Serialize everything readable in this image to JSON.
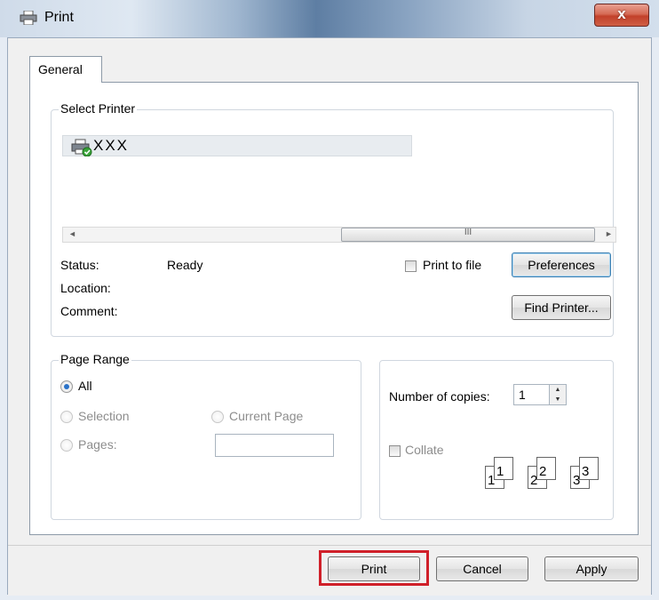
{
  "window": {
    "title": "Print",
    "close_label": "x"
  },
  "tabs": [
    {
      "label": "General"
    }
  ],
  "select_printer": {
    "group_label": "Select Printer",
    "printers": [
      {
        "name": "XXX"
      }
    ],
    "status_label": "Status:",
    "status_value": "Ready",
    "location_label": "Location:",
    "comment_label": "Comment:",
    "print_to_file_label": "Print to file",
    "print_to_file_checked": false,
    "preferences_label": "Preferences",
    "find_printer_label": "Find Printer...",
    "scrollbar_grip": "III"
  },
  "page_range": {
    "group_label": "Page Range",
    "all_label": "All",
    "selection_label": "Selection",
    "current_page_label": "Current Page",
    "pages_label": "Pages:",
    "pages_value": "",
    "selected": "All"
  },
  "copies": {
    "number_label": "Number of copies:",
    "number_value": "1",
    "collate_label": "Collate",
    "collate_checked": false,
    "collate_pages": [
      "1",
      "2",
      "3"
    ]
  },
  "buttons": {
    "print": "Print",
    "cancel": "Cancel",
    "apply": "Apply"
  },
  "colors": {
    "highlight": "#d0202a",
    "radio_selected": "#2a72c8",
    "close_button": "#c2412a"
  }
}
